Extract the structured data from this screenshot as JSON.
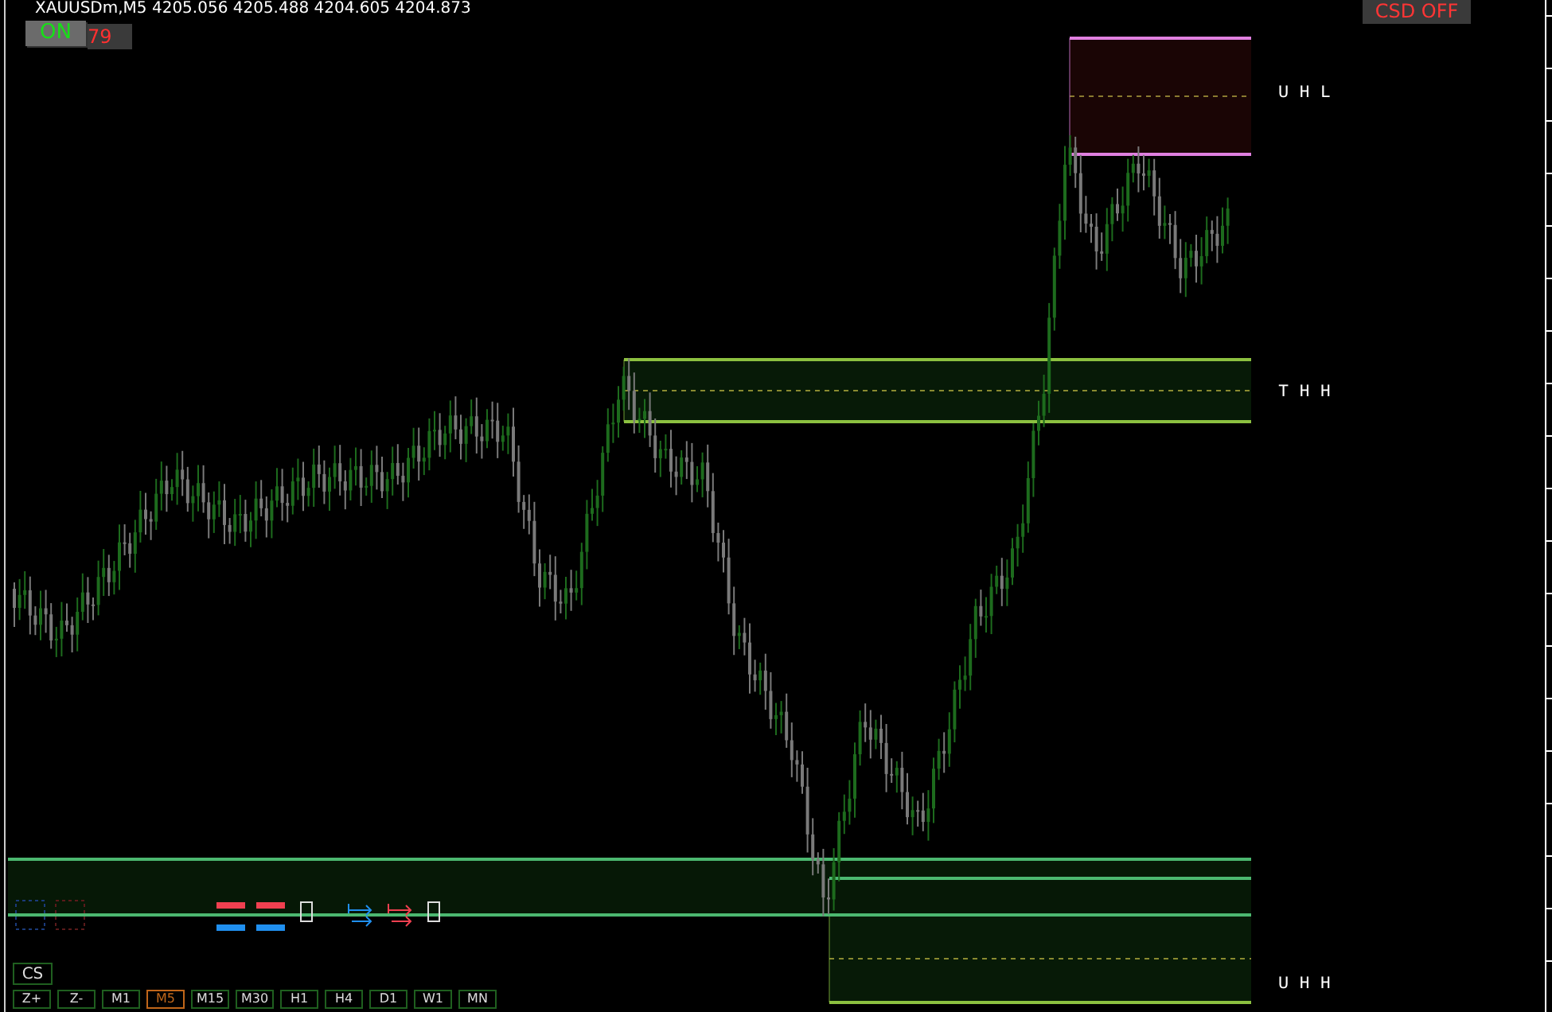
{
  "chart": {
    "title": "XAUUSDm,M5  4205.056 4205.488 4204.605 4204.873",
    "toggle": {
      "label": "ON",
      "on": true
    },
    "counter": "79",
    "csd_button": "CSD OFF",
    "zones": [
      {
        "label": "U H L",
        "kind": "supply"
      },
      {
        "label": "T H H",
        "kind": "demand"
      },
      {
        "label": "U H H",
        "kind": "demand"
      }
    ]
  },
  "cs_button": "CS",
  "timeframes": [
    {
      "label": "Z+",
      "selected": false
    },
    {
      "label": "Z-",
      "selected": false
    },
    {
      "label": "M1",
      "selected": false
    },
    {
      "label": "M5",
      "selected": true
    },
    {
      "label": "M15",
      "selected": false
    },
    {
      "label": "M30",
      "selected": false
    },
    {
      "label": "H1",
      "selected": false
    },
    {
      "label": "H4",
      "selected": false
    },
    {
      "label": "D1",
      "selected": false
    },
    {
      "label": "W1",
      "selected": false
    },
    {
      "label": "MN",
      "selected": false
    }
  ]
}
